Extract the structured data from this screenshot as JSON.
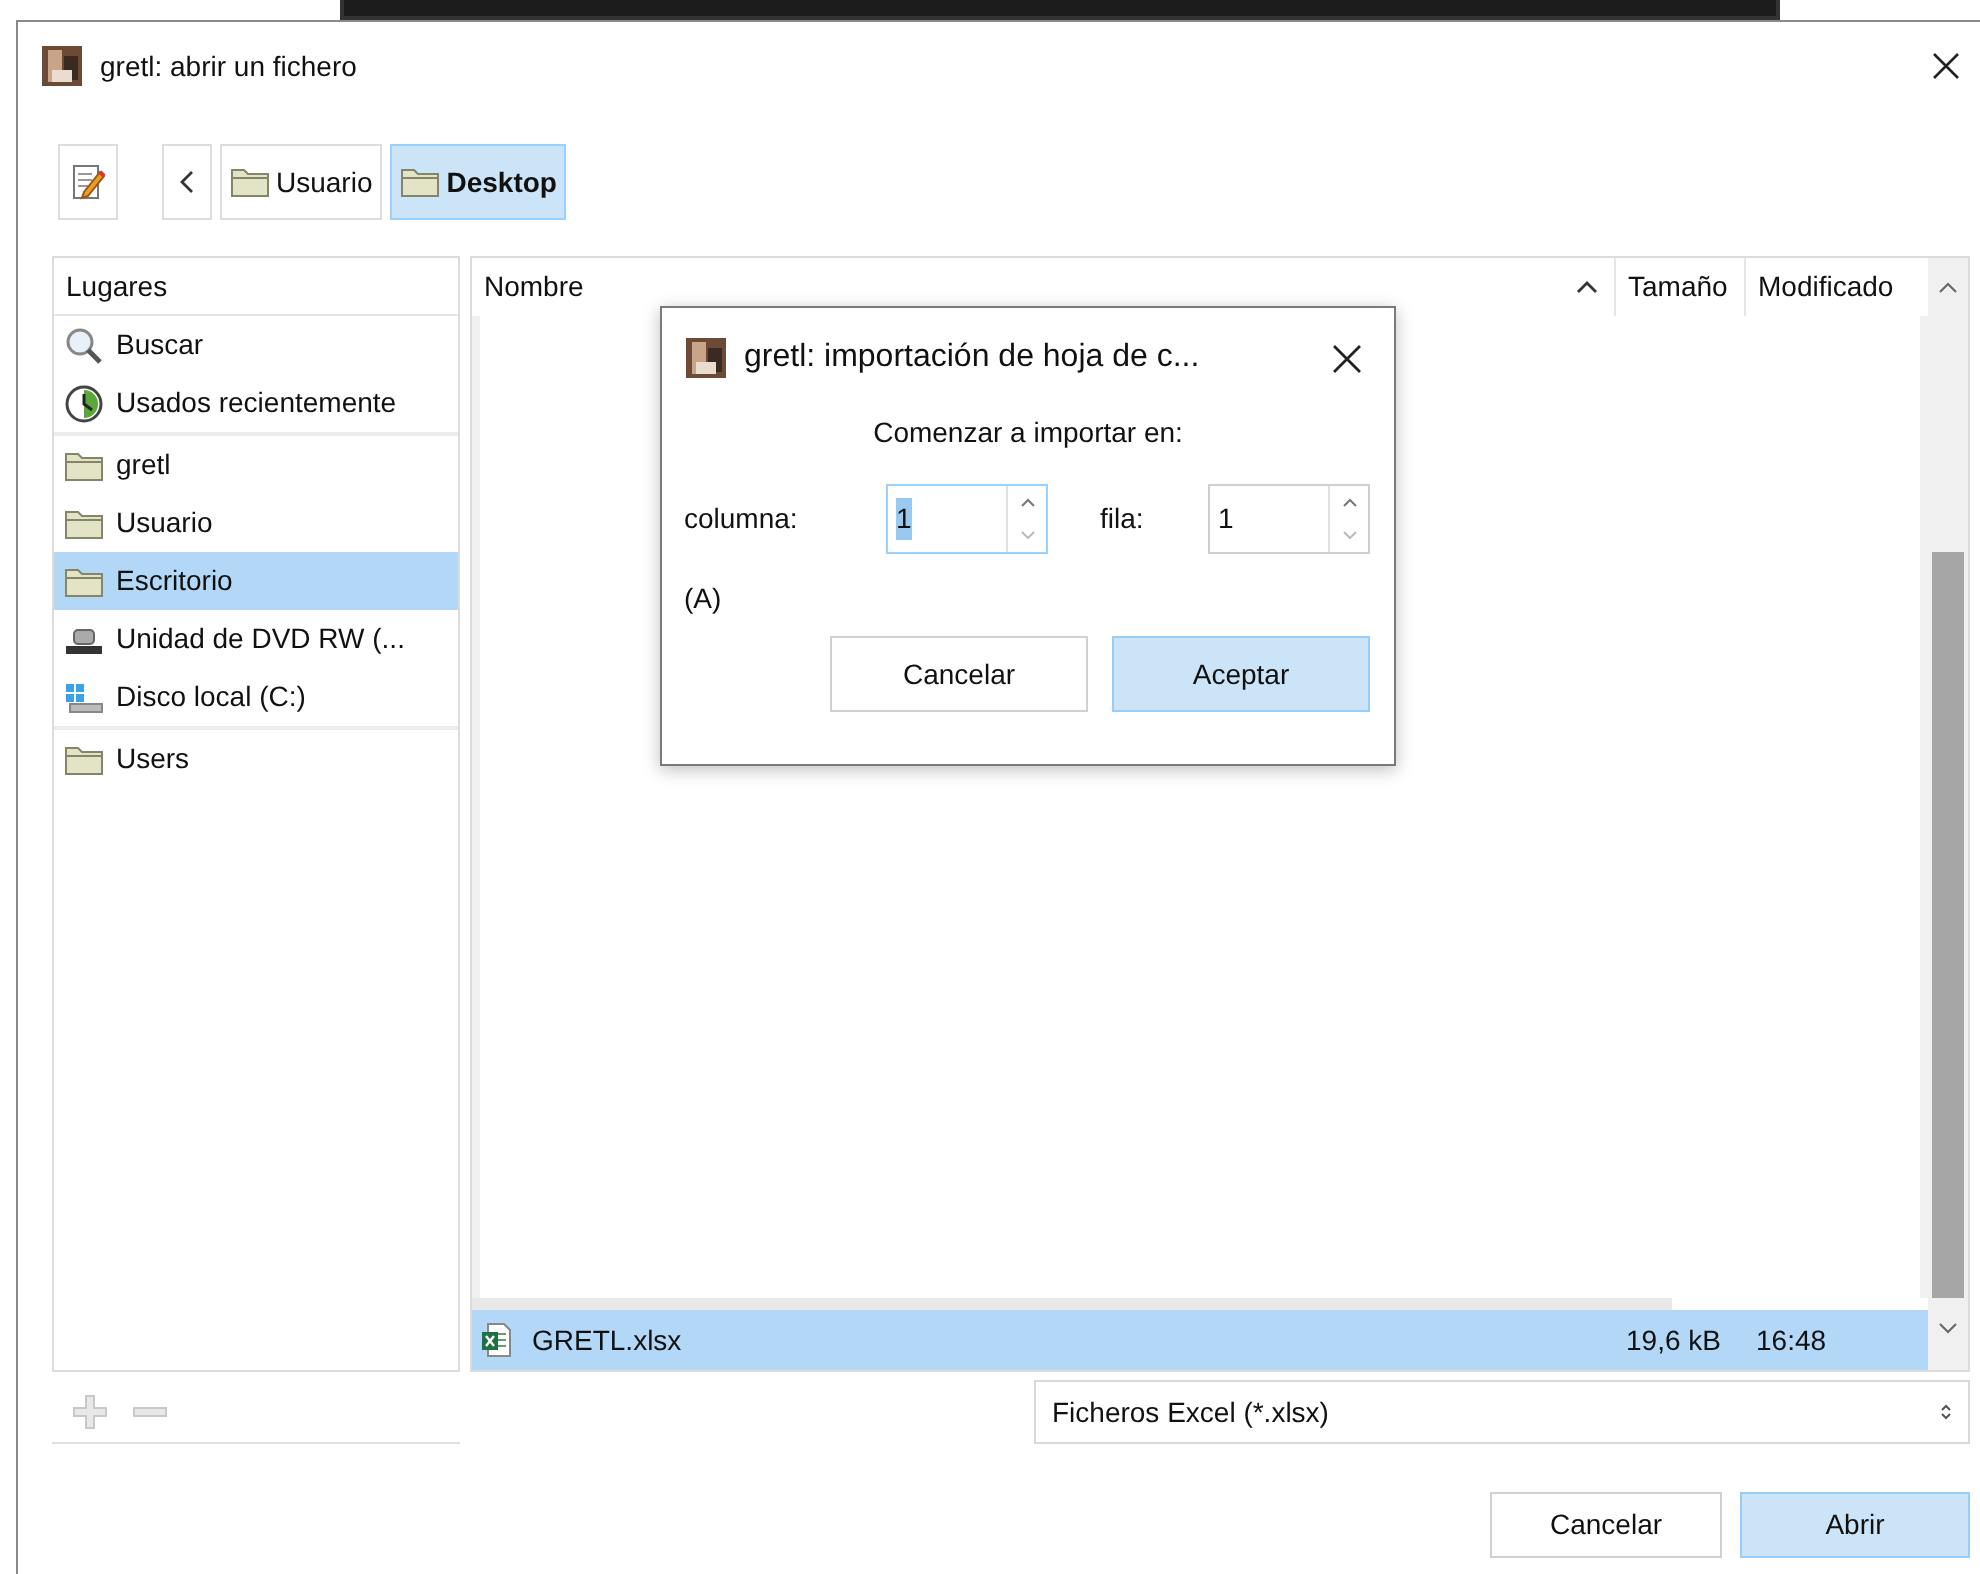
{
  "window": {
    "title": "gretl: abrir un fichero"
  },
  "path_bar": {
    "buttons": [
      {
        "label": "Usuario",
        "selected": false
      },
      {
        "label": "Desktop",
        "selected": true
      }
    ]
  },
  "places": {
    "header": "Lugares",
    "groups": [
      [
        {
          "label": "Buscar",
          "kind": "search",
          "selected": false
        },
        {
          "label": "Usados recientemente",
          "kind": "recent",
          "selected": false
        }
      ],
      [
        {
          "label": "gretl",
          "kind": "folder",
          "selected": false
        },
        {
          "label": "Usuario",
          "kind": "folder",
          "selected": false
        },
        {
          "label": "Escritorio",
          "kind": "folder",
          "selected": true
        },
        {
          "label": "Unidad de DVD RW (...",
          "kind": "dvd",
          "selected": false
        },
        {
          "label": "Disco local (C:)",
          "kind": "disk",
          "selected": false
        }
      ],
      [
        {
          "label": "Users",
          "kind": "folder",
          "selected": false
        }
      ]
    ]
  },
  "files": {
    "columns": [
      {
        "label": "Nombre",
        "sorted": true
      },
      {
        "label": "Tamaño",
        "sorted": false
      },
      {
        "label": "Modificado",
        "sorted": false
      }
    ],
    "rows": [
      {
        "name": "GRETL.xlsx",
        "size": "19,6 kB",
        "modified": "16:48",
        "selected": true
      }
    ]
  },
  "filter": {
    "value": "Ficheros Excel (*.xlsx)"
  },
  "buttons": [
    {
      "label": "Cancelar",
      "default": false
    },
    {
      "label": "Abrir",
      "default": true
    }
  ],
  "dialog": {
    "title": "gretl: importación de hoja de c...",
    "heading": "Comenzar a importar en:",
    "fields": [
      {
        "label": "columna:",
        "value": "1",
        "focused": true
      },
      {
        "label": "fila:",
        "value": "1",
        "focused": false
      }
    ],
    "column_letter": "(A)",
    "buttons": [
      {
        "label": "Cancelar",
        "default": false
      },
      {
        "label": "Aceptar",
        "default": true
      }
    ]
  }
}
